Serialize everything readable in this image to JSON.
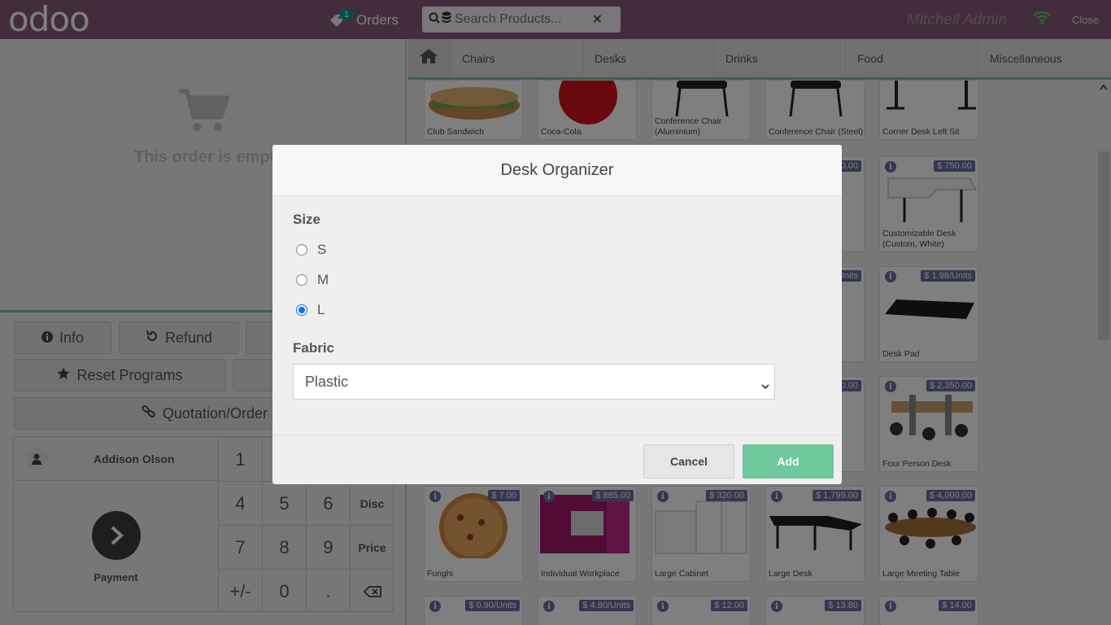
{
  "header": {
    "logo": "odoo",
    "orders_label": "Orders",
    "orders_count": "1",
    "search_placeholder": "Search Products...",
    "user_name": "Mitchell Admin",
    "close_label": "Close"
  },
  "order": {
    "empty_text": "This order is empty"
  },
  "controls": {
    "info": "Info",
    "refund": "Refund",
    "reset_programs": "Reset Programs",
    "quotation_order": "Quotation/Order"
  },
  "numpad": {
    "customer_name": "Addison Olson",
    "payment_label": "Payment",
    "keys": [
      "1",
      "4",
      "5",
      "6",
      "Disc",
      "7",
      "8",
      "9",
      "Price",
      "+/-",
      "0",
      "."
    ]
  },
  "categories": [
    "Chairs",
    "Desks",
    "Drinks",
    "Food",
    "Miscellaneous"
  ],
  "products": [
    {
      "name": "Club Sandwich",
      "price": ""
    },
    {
      "name": "Coca-Cola",
      "price": ""
    },
    {
      "name": "Conference Chair (Aluminium)",
      "price": ""
    },
    {
      "name": "Conference Chair (Steel)",
      "price": ""
    },
    {
      "name": "Corner Desk Left Sit",
      "price": ""
    },
    {
      "name": "Customizable Desk (Custom, White)",
      "price": "$ 750.00"
    },
    {
      "name": "Desk Pad",
      "price": "$ 1.98/Units"
    },
    {
      "name": "Four Person Desk",
      "price": "$ 2,350.00"
    },
    {
      "name": "Funghi",
      "price": "$ 7.00"
    },
    {
      "name": "Individual Workplace",
      "price": "$ 885.00"
    },
    {
      "name": "Large Cabinet",
      "price": "$ 320.00"
    },
    {
      "name": "Large Desk",
      "price": "$ 1,799.00"
    },
    {
      "name": "Large Meeting Table",
      "price": "$ 4,000.00"
    },
    {
      "name": "",
      "price": "$ 0.90/Units"
    },
    {
      "name": "",
      "price": "$ 4.80/Units"
    },
    {
      "name": "",
      "price": "$ 12.00"
    },
    {
      "name": "",
      "price": "$ 13.80"
    },
    {
      "name": "",
      "price": "$ 14.00"
    },
    {
      "name": "",
      "price": "0.00"
    },
    {
      "name": "",
      "price": "Units"
    },
    {
      "name": "",
      "price": "0.00"
    }
  ],
  "dialog": {
    "title": "Desk Organizer",
    "size_label": "Size",
    "size_options": [
      "S",
      "M",
      "L"
    ],
    "size_selected": "L",
    "fabric_label": "Fabric",
    "fabric_value": "Plastic",
    "cancel": "Cancel",
    "add": "Add"
  },
  "colors": {
    "header": "#875a7b",
    "accent": "#6ec89b",
    "price_tag": "#6b6f9e"
  }
}
